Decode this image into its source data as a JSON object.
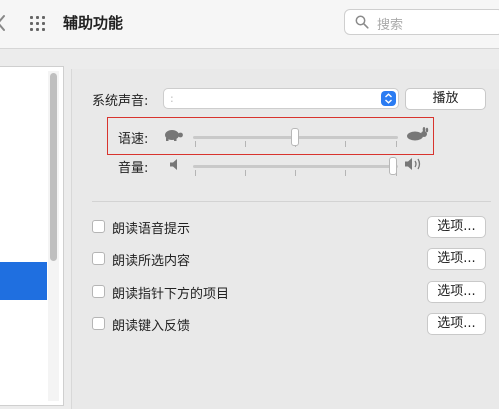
{
  "header": {
    "title": "辅助功能",
    "search_placeholder": "搜索"
  },
  "speech": {
    "voice_label": "系统声音:",
    "voice_value": ":",
    "play_button": "播放",
    "rate_label": "语速:",
    "volume_label": "音量:"
  },
  "options": [
    {
      "label": "朗读语音提示",
      "button": "选项...",
      "checked": false
    },
    {
      "label": "朗读所选内容",
      "button": "选项...",
      "checked": false
    },
    {
      "label": "朗读指针下方的项目",
      "button": "选项...",
      "checked": false
    },
    {
      "label": "朗读键入反馈",
      "button": "选项...",
      "checked": false
    }
  ],
  "colors": {
    "accent": "#1f6fe0",
    "highlight": "#d8342e"
  },
  "icons": [
    "back-chevron-icon",
    "grid-icon",
    "search-icon",
    "turtle-icon",
    "hare-icon",
    "speaker-low-icon",
    "speaker-high-icon"
  ]
}
